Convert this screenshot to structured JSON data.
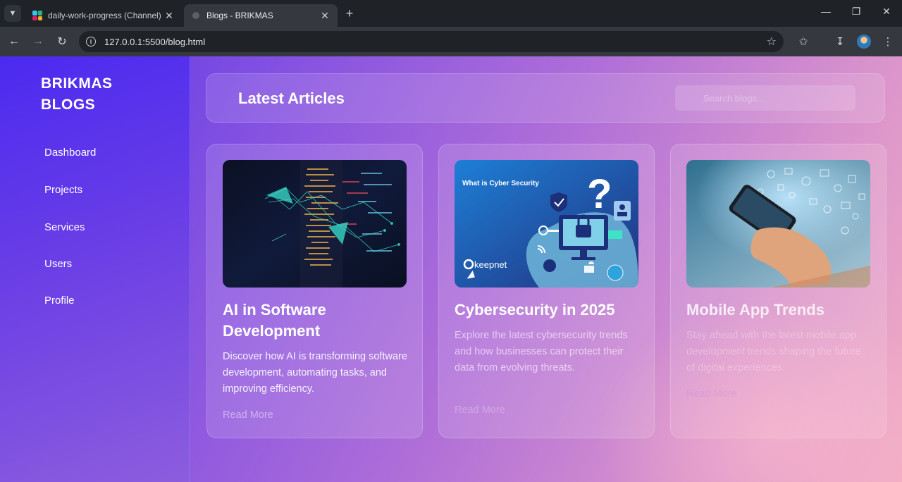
{
  "browser": {
    "tabs": [
      {
        "title": "daily-work-progress (Channel)",
        "active": false
      },
      {
        "title": "Blogs - BRIKMAS",
        "active": true
      }
    ],
    "url": "127.0.0.1:5500/blog.html"
  },
  "sidebar": {
    "brand_line1": "BRIKMAS",
    "brand_line2": "BLOGS",
    "items": [
      {
        "label": "Dashboard"
      },
      {
        "label": "Projects"
      },
      {
        "label": "Services"
      },
      {
        "label": "Users"
      },
      {
        "label": "Profile"
      }
    ]
  },
  "header": {
    "title": "Latest Articles",
    "search_placeholder": "Search blogs..."
  },
  "cards": [
    {
      "title": "AI in Software Development",
      "description": "Discover how AI is transforming software development, automating tasks, and improving efficiency.",
      "link": "Read More"
    },
    {
      "title": "Cybersecurity in 2025",
      "image_caption": "What is Cyber Security",
      "image_logo": "keepnet",
      "description": "Explore the latest cybersecurity trends and how businesses can protect their data from evolving threats.",
      "link": "Read More"
    },
    {
      "title": "Mobile App Trends",
      "description": "Stay ahead with the latest mobile app development trends shaping the future of digital experiences.",
      "link": "Read More"
    }
  ],
  "colors": {
    "sidebar_top": "#4b2af0",
    "gradient_end": "#f2adc4",
    "text": "#ffffff"
  }
}
